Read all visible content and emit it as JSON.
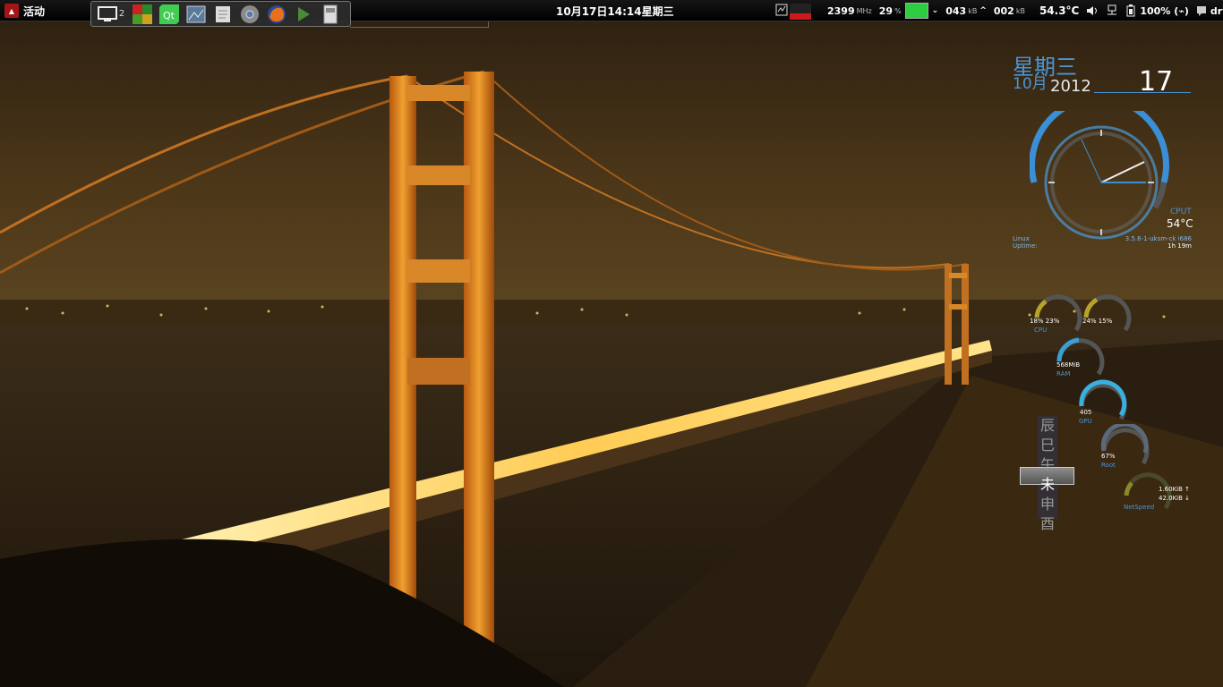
{
  "panel": {
    "activities_label": "活动",
    "workspace_count": "2",
    "clock": "10月17日14:14星期三",
    "cpu_freq": "2399",
    "cpu_freq_unit": "MHz",
    "cpu_percent": "29",
    "cpu_percent_unit": "%",
    "net_down": "043",
    "net_down_unit": "kB",
    "net_up": "002",
    "net_up_unit": "kB",
    "temperature": "54.3°C",
    "battery": "100% (⌁)",
    "user": "dryland",
    "dock_apps": [
      "display-icon",
      "app-grid-icon",
      "qt-creator-icon",
      "image-viewer-icon",
      "text-editor-icon",
      "chrome-icon",
      "firefox-icon",
      "terminal-icon",
      "files-icon"
    ],
    "colors": {
      "panel_bg": "#000000",
      "cpu_bar": "#2ecc40",
      "graph_bar": "#cc1a1a"
    }
  },
  "desktop": {
    "date": {
      "weekday": "星期三",
      "month": "10月",
      "year": "2012",
      "day": "17"
    },
    "clock_widget": {
      "cpu_label": "CPUT",
      "cpu_temp": "54°C",
      "os_label": "Linux",
      "kernel": "3.5.6-1-uksm-ck i686",
      "uptime_label": "Uptime:",
      "uptime": "1h 19m",
      "accent": "#3a8fd6"
    },
    "rings": {
      "cpu": {
        "text": "18% 23%",
        "label": "CPU",
        "values": [
          18,
          23
        ]
      },
      "cpu2": {
        "text": "24% 15%",
        "values": [
          24,
          15
        ]
      },
      "ram": {
        "text": "568MiB",
        "label": "RAM"
      },
      "gpu": {
        "text": "405",
        "label": "GPU"
      },
      "root": {
        "text": "67%",
        "label": "Root",
        "value": 67
      },
      "net": {
        "up": "1.60KiB ↑",
        "down": "42.0KiB ↓",
        "label": "NetSpeed"
      }
    },
    "branches": [
      "辰",
      "巳",
      "午",
      "未",
      "申",
      "酉"
    ],
    "current_branch_index": 3
  }
}
